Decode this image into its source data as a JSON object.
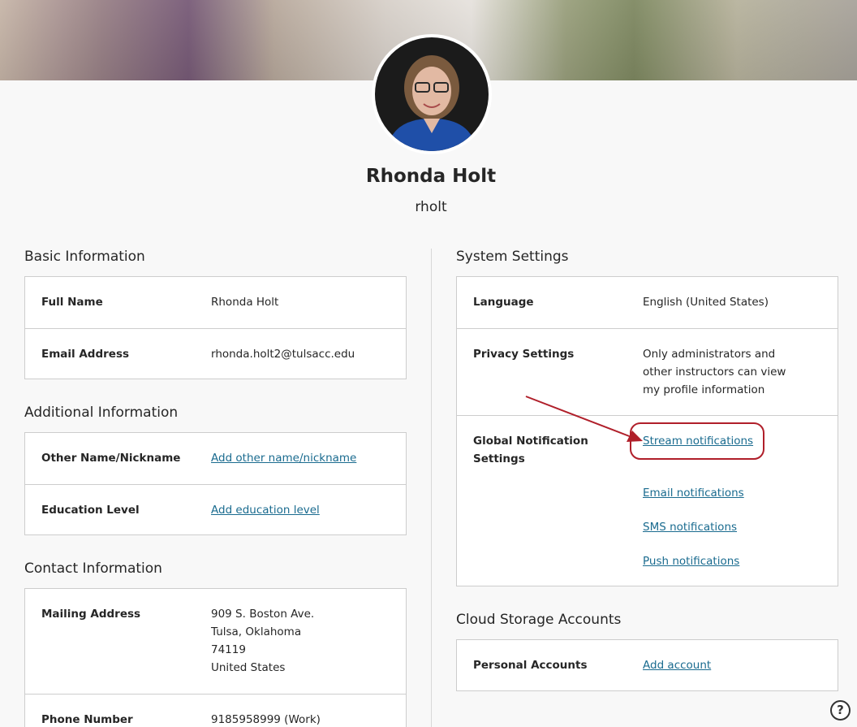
{
  "profile": {
    "name": "Rhonda Holt",
    "username": "rholt"
  },
  "basic_info": {
    "title": "Basic Information",
    "rows": [
      {
        "label": "Full Name",
        "value": "Rhonda Holt"
      },
      {
        "label": "Email Address",
        "value": "rhonda.holt2@tulsacc.edu"
      }
    ]
  },
  "additional_info": {
    "title": "Additional Information",
    "rows": [
      {
        "label": "Other Name/Nickname",
        "link": "Add other name/nickname"
      },
      {
        "label": "Education Level",
        "link": "Add education level"
      }
    ]
  },
  "contact_info": {
    "title": "Contact Information",
    "mailing": {
      "label": "Mailing Address",
      "lines": [
        "909 S. Boston Ave.",
        "Tulsa, Oklahoma",
        "74119",
        "United States"
      ]
    },
    "phone": {
      "label": "Phone Number",
      "value": "9185958999 (Work)"
    }
  },
  "system_settings": {
    "title": "System Settings",
    "language": {
      "label": "Language",
      "value": "English (United States)"
    },
    "privacy": {
      "label": "Privacy Settings",
      "lines": [
        "Only administrators and",
        "other instructors can view",
        "my profile information"
      ]
    },
    "notifications": {
      "label_lines": [
        "Global Notification",
        "Settings"
      ],
      "links": [
        "Stream notifications",
        "Email notifications",
        "SMS notifications",
        "Push notifications"
      ]
    }
  },
  "cloud_storage": {
    "title": "Cloud Storage Accounts",
    "row": {
      "label": "Personal Accounts",
      "link": "Add account"
    }
  },
  "help": {
    "glyph": "?"
  },
  "colors": {
    "link": "#1a6b8f",
    "annotation": "#b01f2a",
    "card_border": "#cdcdcd",
    "background": "#f8f8f8"
  }
}
